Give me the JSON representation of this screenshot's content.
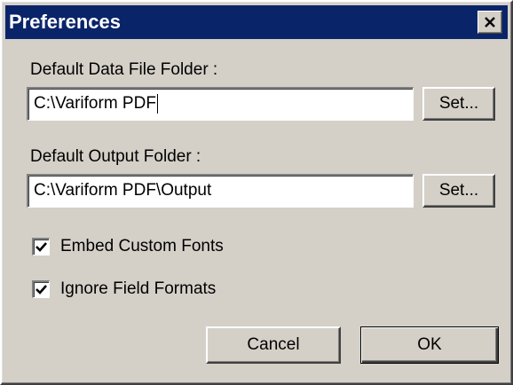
{
  "window": {
    "title": "Preferences",
    "close_icon": "close-icon"
  },
  "data_folder": {
    "label": "Default Data File Folder :",
    "value": "C:\\Variform PDF",
    "set_label": "Set..."
  },
  "output_folder": {
    "label": "Default Output Folder :",
    "value": "C:\\Variform PDF\\Output",
    "set_label": "Set..."
  },
  "options": [
    {
      "label": "Embed Custom Fonts",
      "checked": true
    },
    {
      "label": "Ignore Field Formats",
      "checked": true
    }
  ],
  "buttons": {
    "cancel": "Cancel",
    "ok": "OK"
  },
  "colors": {
    "titlebar": "#0a246a",
    "face": "#d4d0c8"
  }
}
